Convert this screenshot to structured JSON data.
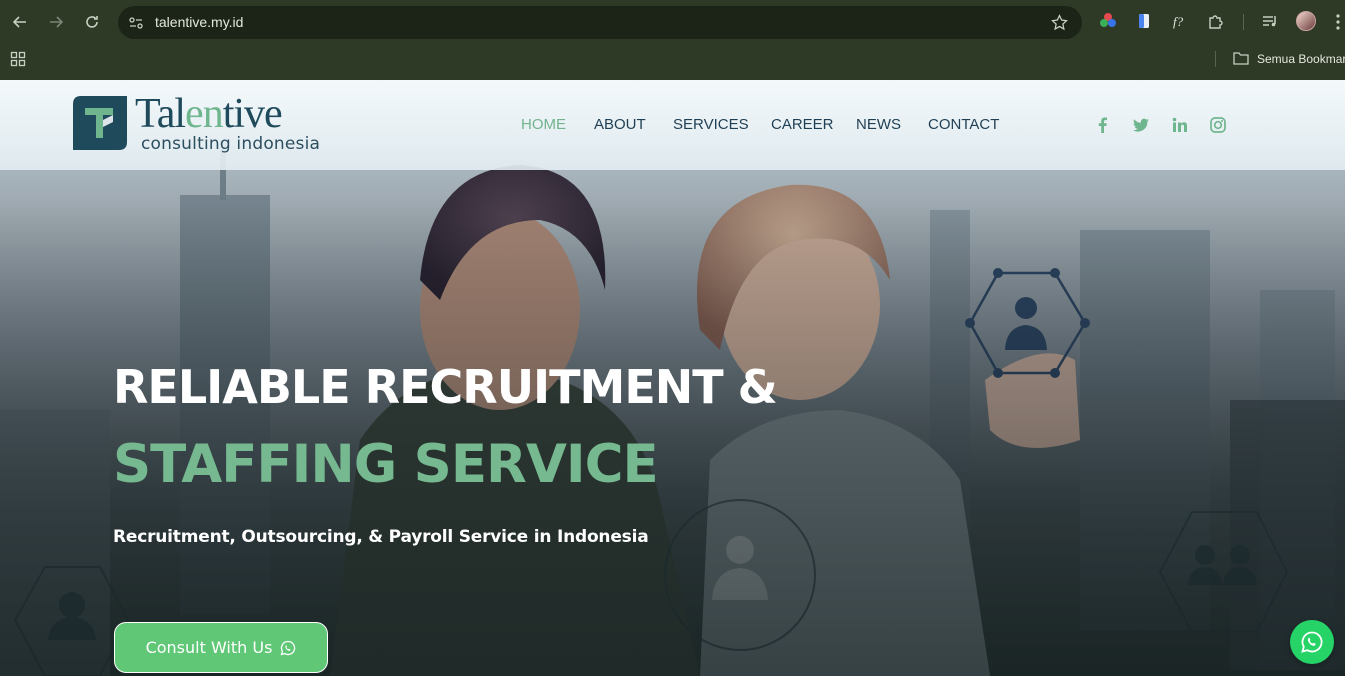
{
  "browser": {
    "url": "talentive.my.id",
    "bookmark_folder": "Semua Bookmark"
  },
  "site": {
    "logo": {
      "word_pre": "Tal",
      "word_accent": "en",
      "word_post": "tive",
      "subtitle": "consulting indonesia"
    },
    "menu": [
      {
        "label": "HOME",
        "active": true
      },
      {
        "label": "ABOUT",
        "active": false
      },
      {
        "label": "SERVICES",
        "active": false
      },
      {
        "label": "CAREER",
        "active": false
      },
      {
        "label": "NEWS",
        "active": false
      },
      {
        "label": "CONTACT",
        "active": false
      }
    ],
    "social": [
      "facebook-icon",
      "twitter-icon",
      "linkedin-icon",
      "instagram-icon"
    ],
    "hero": {
      "title_line1": "RELIABLE RECRUITMENT &",
      "title_line2": "STAFFING SERVICE",
      "subtitle": "Recruitment, Outsourcing, & Payroll Service in Indonesia",
      "cta_label": "Consult With Us"
    },
    "colors": {
      "accent_green": "#76b88f",
      "navy": "#1f3f54",
      "cta_green": "#5fc775",
      "whatsapp": "#25d366"
    }
  }
}
